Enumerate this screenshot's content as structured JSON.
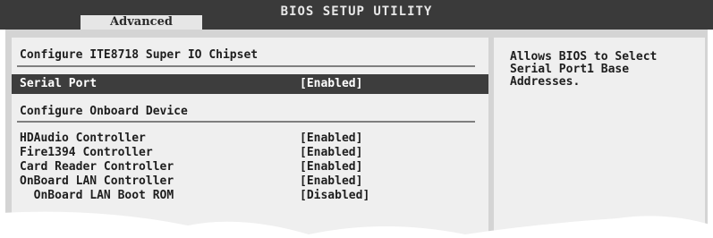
{
  "header": {
    "title": "BIOS SETUP UTILITY",
    "active_tab": "Advanced"
  },
  "left": {
    "section1_title": "Configure ITE8718 Super IO Chipset",
    "serial_port": {
      "label": "Serial Port",
      "value": "[Enabled]"
    },
    "section2_title": "Configure Onboard Device",
    "items": [
      {
        "label": "HDAudio Controller",
        "value": "[Enabled]"
      },
      {
        "label": "Fire1394 Controller",
        "value": "[Enabled]"
      },
      {
        "label": "Card Reader Controller",
        "value": "[Enabled]"
      },
      {
        "label": "OnBoard LAN Controller",
        "value": "[Enabled]"
      },
      {
        "label": "  OnBoard LAN Boot ROM",
        "value": "[Disabled]"
      }
    ]
  },
  "help": {
    "text": "Allows BIOS to Select Serial Port1 Base Addresses."
  },
  "colors": {
    "topbar": "#3a3a3a",
    "highlight": "#3d3d3d",
    "panel": "#efefef"
  }
}
